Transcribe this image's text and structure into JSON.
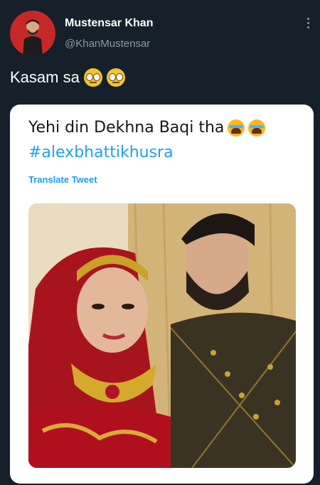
{
  "tweet": {
    "author_name": "Mustensar Khan",
    "author_handle": "@KhanMustensar",
    "text": "Kasam sa",
    "emojis": [
      "rolling-eyes-emoji",
      "rolling-eyes-emoji"
    ],
    "more_icon": "more-options-icon"
  },
  "quoted_card": {
    "title": "Yehi din Dekhna Baqi tha",
    "title_emojis": [
      "crying-emoji",
      "crying-emoji"
    ],
    "hashtag": "#alexbhattikhusra",
    "translate_label": "Translate Tweet",
    "image": "wedding-couple-photo"
  },
  "colors": {
    "background": "#15202b",
    "link": "#1da1f2",
    "secondary_text": "#8899a6",
    "card": "#ffffff"
  }
}
